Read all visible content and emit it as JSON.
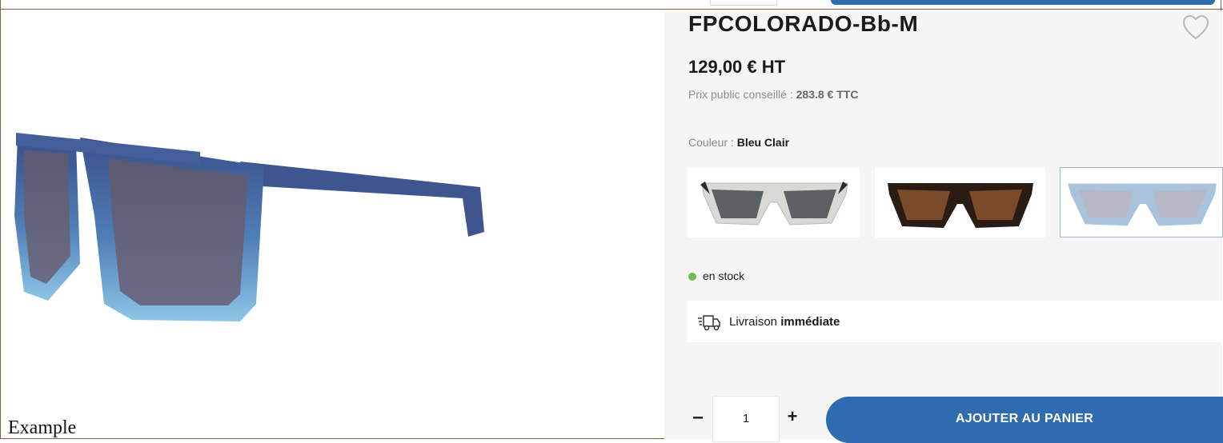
{
  "product": {
    "title": "FPCOLORADO-Bb-M",
    "price": "129,00 € HT",
    "rrp_label": "Prix public conseillé : ",
    "rrp_value": "283.8 € TTC",
    "color_label": "Couleur : ",
    "color_value": "Bleu Clair",
    "swatches": [
      {
        "name": "clear-grey",
        "frame": "#d8d8d4",
        "lens": "#5c6063"
      },
      {
        "name": "dark-tortoise",
        "frame": "#2a1c14",
        "lens": "#7a4a2a"
      },
      {
        "name": "light-blue",
        "frame": "#a9c3dc",
        "lens": "#b7b8c6"
      }
    ],
    "selected_swatch": 2,
    "stock": "en stock",
    "delivery_prefix": "Livraison ",
    "delivery_bold": "immédiate",
    "quantity": "1",
    "minus": "–",
    "plus": "+",
    "add_to_cart": "AJOUTER AU PANIER"
  },
  "caption": "Example",
  "colors": {
    "accent": "#2f6bb0",
    "stock_dot": "#6cbf4b",
    "panel_bg": "#f5f5f5",
    "border": "#8b5a3c"
  }
}
